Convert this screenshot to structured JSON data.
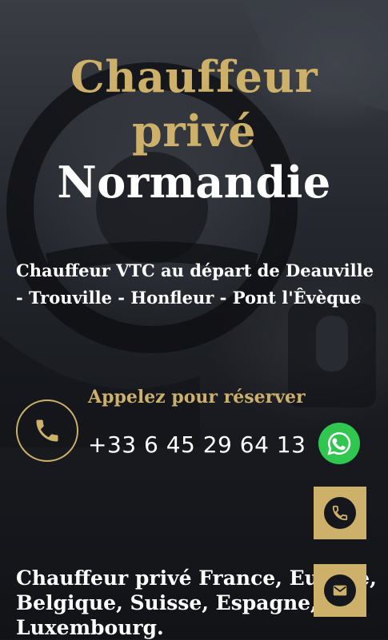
{
  "hero": {
    "title_line1": "Chauffeur",
    "title_line2": "privé",
    "title_line3": "Normandie",
    "subtitle": "Chauffeur VTC au départ de Deauville - Trouville - Honfleur - Pont l'Êvèque"
  },
  "contact": {
    "call_label": "Appelez pour réserver",
    "phone_number": "+33 6 45 29 64 13",
    "phone_icon": "phone-icon",
    "whatsapp_icon": "whatsapp-icon"
  },
  "floating_actions": {
    "call_icon": "phone-icon",
    "email_icon": "email-icon"
  },
  "footer": {
    "text": "Chauffeur privé France, Europe, Belgique, Suisse, Espagne, Luxembourg."
  },
  "colors": {
    "gold": "#cdb06a",
    "white": "#ffffff",
    "whatsapp_green": "#30c650",
    "background": "#15171c"
  }
}
